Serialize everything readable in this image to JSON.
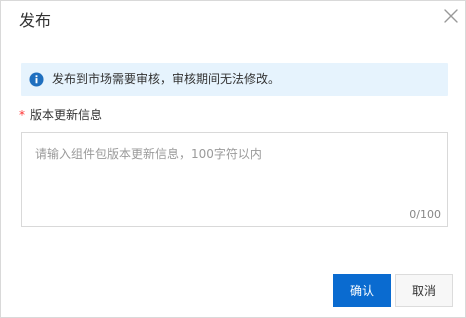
{
  "dialog": {
    "title": "发布",
    "close_icon": "close-icon"
  },
  "notice": {
    "icon": "info-icon",
    "text": "发布到市场需要审核，审核期间无法修改。",
    "background_color": "#e6f3fd",
    "icon_color": "#1f6fbf"
  },
  "form": {
    "required_mark": "*",
    "label": "版本更新信息",
    "placeholder": "请输入组件包版本更新信息，100字符以内",
    "value": "",
    "counter": "0/100"
  },
  "footer": {
    "confirm_label": "确认",
    "cancel_label": "取消",
    "primary_color": "#0a6bd0"
  }
}
